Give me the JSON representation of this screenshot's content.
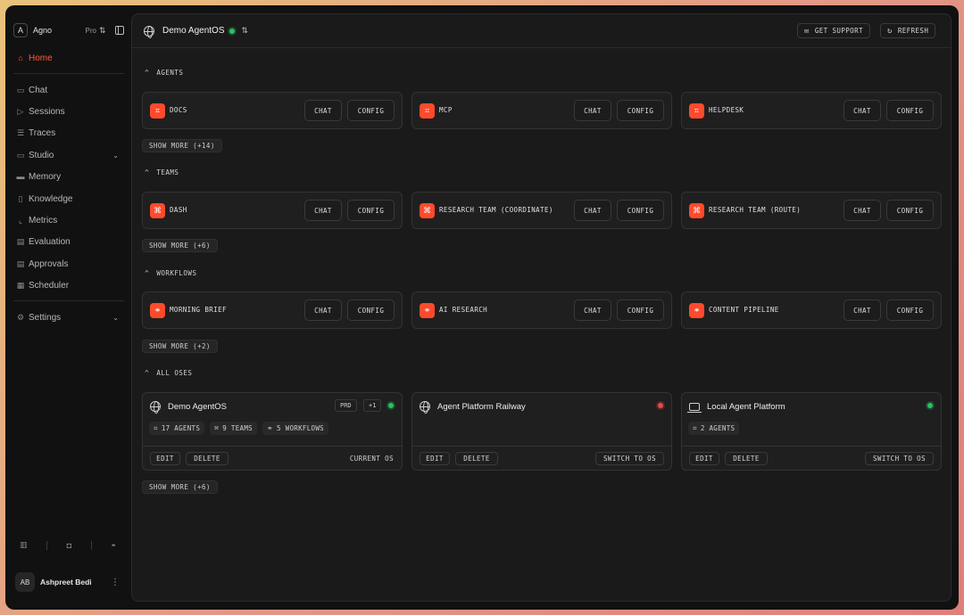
{
  "workspace": {
    "avatar": "A",
    "name": "Agno",
    "plan": "Pro"
  },
  "nav": {
    "home": "Home",
    "chat": "Chat",
    "sessions": "Sessions",
    "traces": "Traces",
    "studio": "Studio",
    "memory": "Memory",
    "knowledge": "Knowledge",
    "metrics": "Metrics",
    "evaluation": "Evaluation",
    "approvals": "Approvals",
    "scheduler": "Scheduler",
    "settings": "Settings"
  },
  "user": {
    "initials": "AB",
    "name": "Ashpreet Bedi"
  },
  "topbar": {
    "current_os": "Demo AgentOS",
    "get_support": "GET SUPPORT",
    "refresh": "REFRESH"
  },
  "sections": {
    "agents": {
      "title": "AGENTS",
      "items": [
        {
          "name": "DOCS",
          "chat": "CHAT",
          "config": "CONFIG"
        },
        {
          "name": "MCP",
          "chat": "CHAT",
          "config": "CONFIG"
        },
        {
          "name": "HELPDESK",
          "chat": "CHAT",
          "config": "CONFIG"
        }
      ],
      "show_more": "SHOW MORE (+14)"
    },
    "teams": {
      "title": "TEAMS",
      "items": [
        {
          "name": "DASH",
          "chat": "CHAT",
          "config": "CONFIG"
        },
        {
          "name": "RESEARCH TEAM (COORDINATE)",
          "chat": "CHAT",
          "config": "CONFIG"
        },
        {
          "name": "RESEARCH TEAM (ROUTE)",
          "chat": "CHAT",
          "config": "CONFIG"
        }
      ],
      "show_more": "SHOW MORE (+6)"
    },
    "workflows": {
      "title": "WORKFLOWS",
      "items": [
        {
          "name": "MORNING BRIEF",
          "chat": "CHAT",
          "config": "CONFIG"
        },
        {
          "name": "AI RESEARCH",
          "chat": "CHAT",
          "config": "CONFIG"
        },
        {
          "name": "CONTENT PIPELINE",
          "chat": "CHAT",
          "config": "CONFIG"
        }
      ],
      "show_more": "SHOW MORE (+2)"
    },
    "oses": {
      "title": "ALL OSES",
      "items": [
        {
          "name": "Demo AgentOS",
          "tag_env": "PRD",
          "tag_extra": "+1",
          "status_color": "#23c55e",
          "stats": [
            "17 AGENTS",
            "9 TEAMS",
            "5 WORKFLOWS"
          ],
          "edit": "EDIT",
          "delete": "DELETE",
          "status_label": "CURRENT OS"
        },
        {
          "name": "Agent Platform Railway",
          "status_color": "#e5484d",
          "edit": "EDIT",
          "delete": "DELETE",
          "action": "SWITCH TO OS"
        },
        {
          "name": "Local Agent Platform",
          "status_color": "#23c55e",
          "stats": [
            "2 AGENTS"
          ],
          "edit": "EDIT",
          "delete": "DELETE",
          "action": "SWITCH TO OS"
        }
      ],
      "show_more": "SHOW MORE (+6)"
    }
  },
  "colors": {
    "accent": "#ff4a2b",
    "active_nav": "#ff5a3c",
    "background": "#111111",
    "panel": "#1a1a1a",
    "status_green": "#23c55e",
    "status_red": "#e5484d"
  },
  "icons": {
    "agent": "agent-icon",
    "team": "team-icon",
    "workflow": "workflow-icon",
    "globe": "globe-icon",
    "laptop": "laptop-icon"
  }
}
